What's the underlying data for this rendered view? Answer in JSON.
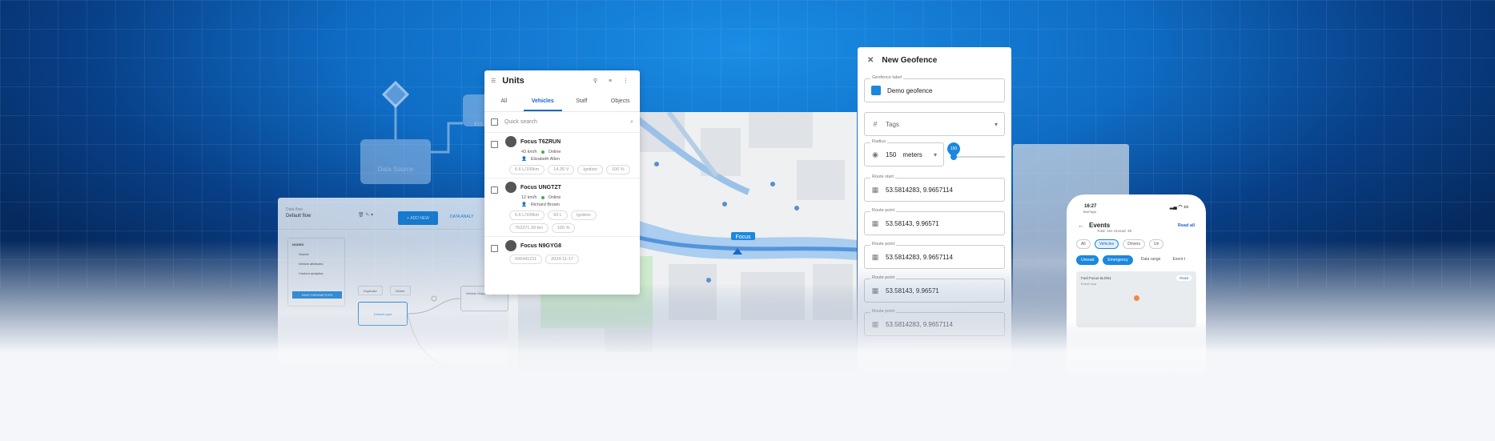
{
  "diagram": {
    "data_source": "Data Source",
    "partial_label": "Ent"
  },
  "flow_editor": {
    "flow_label": "Data flow",
    "flow_name": "Default flow",
    "add_button": "ADD NEW",
    "data_button": "DATA ANALY",
    "nodes_title": "NODES",
    "nodes": [
      "Source",
      "Vehicle attributes",
      "Custom analytics"
    ],
    "save_button": "SAVE PARAMETERS",
    "duplicate_button": "Duplicate",
    "delete_button": "Delete",
    "node_default_input": "Default input",
    "node_output": "Vehicle Output Endpoint"
  },
  "units": {
    "title": "Units",
    "tabs": [
      "All",
      "Vehicles",
      "Staff",
      "Objects"
    ],
    "active_tab": "Vehicles",
    "search_placeholder": "Quick search",
    "vehicles": [
      {
        "name": "Focus T6ZRUN",
        "speed": "43 km/h",
        "status": "Online",
        "driver": "Elizabeth Allen",
        "chips": [
          "6.6 L/100km",
          "14.35 V",
          "Ignition",
          "100 %"
        ]
      },
      {
        "name": "Focus UNGTZT",
        "speed": "12 km/h",
        "status": "Online",
        "driver": "Richard Brown",
        "chips": [
          "6.6 L/100km",
          "50 L",
          "Ignition",
          "762371.39 km",
          "100 %"
        ]
      },
      {
        "name": "Focus N9GYG8",
        "chips": [
          "696441211",
          "2024-11-17"
        ]
      }
    ]
  },
  "map": {
    "marker_label": "Focus"
  },
  "geofence": {
    "title": "New Geofence",
    "label_label": "Geofence label",
    "label_value": "Demo geofence",
    "tags_placeholder": "Tags",
    "radius_label": "Radius",
    "radius_value": "150",
    "radius_unit": "meters",
    "slider_value": "150",
    "route_start_label": "Route start",
    "route_point_label": "Route point",
    "routes": [
      {
        "label": "Route start",
        "value": "53.5814283, 9.9657114"
      },
      {
        "label": "Route point",
        "value": "53.58143, 9.96571"
      },
      {
        "label": "Route point",
        "value": "53.5814283, 9.9657114"
      },
      {
        "label": "Route point",
        "value": "53.58143, 9.96571"
      },
      {
        "label": "Route point",
        "value": "53.5814283, 9.9657114"
      }
    ],
    "accent": "#1b88dd"
  },
  "phone": {
    "time": "16:27",
    "carrier": "TestFlight",
    "title": "Events",
    "totals": "Total: 181      Unread: 38",
    "read_all": "Read all",
    "filters": [
      "All",
      "Vehicles",
      "Drivers",
      "Un"
    ],
    "chips": [
      "Unread",
      "Emergency",
      "Data range",
      "Event t"
    ],
    "map_label": "Fuel Focus 6LGN1",
    "map_sub": "Event hour",
    "map_btn": "Read"
  }
}
